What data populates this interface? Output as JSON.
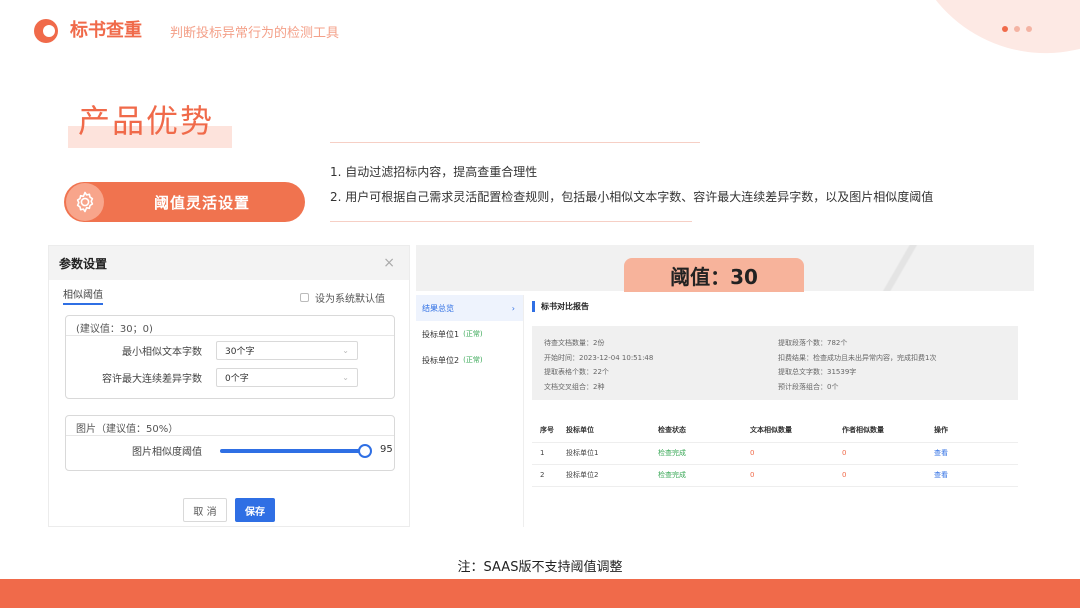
{
  "brand": "标书查重",
  "tagline": "判断投标异常行为的检测工具",
  "title": "产品优势",
  "feature": {
    "label": "阈值灵活设置",
    "icon": "gear-icon"
  },
  "points": [
    "1. 自动过滤招标内容，提高查重合理性",
    "2. 用户可根据自己需求灵活配置检查规则，包括最小相似文本字数、容许最大连续差异字数，以及图片相似度阈值"
  ],
  "dialog": {
    "title": "参数设置",
    "close": "×",
    "tab": "相似阈值",
    "default_check": "设为系统默认值",
    "text_group": {
      "header": "(建议值：30；0)",
      "min_label": "最小相似文本字数",
      "min_value": "30个字",
      "max_label": "容许最大连续差异字数",
      "max_value": "0个字"
    },
    "image_group": {
      "header": "图片（建议值：50%）",
      "label": "图片相似度阈值",
      "value": "95"
    },
    "cancel": "取 消",
    "save": "保存"
  },
  "report": {
    "threshold": "阈值：30",
    "sidebar": [
      {
        "label": "结果总览",
        "tag": "",
        "arrow": "›"
      },
      {
        "label": "投标单位1",
        "tag": "(正常)"
      },
      {
        "label": "投标单位2",
        "tag": "(正常)"
      }
    ],
    "heading": "标书对比报告",
    "summary_left": [
      "待查文档数量：2份",
      "开始时间：2023-12-04 10:51:48",
      "提取表格个数：22个",
      "文档交叉组合：2种"
    ],
    "summary_right": [
      "提取段落个数：782个",
      "扣费结果：检查成功且未出异常内容，完成扣费1次",
      "提取总文字数：31539字",
      "预计段落组合：0个"
    ],
    "columns": [
      "序号",
      "投标单位",
      "检查状态",
      "文本相似数量",
      "作者相似数量",
      "操作"
    ],
    "rows": [
      [
        "1",
        "投标单位1",
        "检查完成",
        "0",
        "0",
        "查看"
      ],
      [
        "2",
        "投标单位2",
        "检查完成",
        "0",
        "0",
        "查看"
      ]
    ]
  },
  "note": "注：SAAS版不支持阈值调整",
  "colors": {
    "accent": "#f06a4a",
    "primary_blue": "#2f6fe4",
    "ok_green": "#3aa857"
  }
}
